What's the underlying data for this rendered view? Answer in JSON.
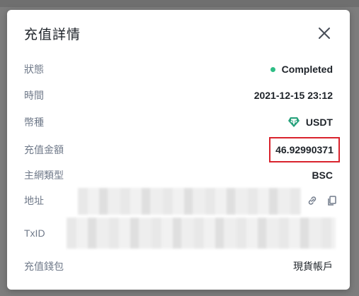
{
  "modal": {
    "title": "充值詳情",
    "close_icon": "close-icon"
  },
  "details": {
    "status": {
      "label": "狀態",
      "value": "Completed",
      "color": "#2ebd85"
    },
    "time": {
      "label": "時間",
      "value": "2021-12-15 23:12"
    },
    "coin": {
      "label": "幣種",
      "value": "USDT",
      "icon": "tether-icon",
      "icon_color": "#26a17b"
    },
    "amount": {
      "label": "充值金額",
      "value": "46.92990371",
      "highlight_color": "#d9232d"
    },
    "network": {
      "label": "主網類型",
      "value": "BSC"
    },
    "address": {
      "label": "地址",
      "icons": [
        "link-icon",
        "copy-icon"
      ]
    },
    "txid": {
      "label": "TxID"
    },
    "wallet": {
      "label": "充值錢包",
      "value": "現貨帳戶"
    }
  }
}
